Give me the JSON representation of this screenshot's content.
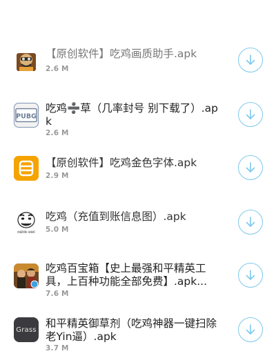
{
  "items": [
    {
      "title": "【原创软件】吃鸡画质助手.apk",
      "size": "2.6 M",
      "icon": "pubg-crate-character-icon"
    },
    {
      "title": "吃鸡➗草（几率封号 别下载了）.apk",
      "size": "2.6 M",
      "icon": "pubg-logo-icon"
    },
    {
      "title": "【原创软件】吃鸡金色字体.apk",
      "size": "2.9 M",
      "icon": "orange-app-icon"
    },
    {
      "title": "吃鸡（充值到账信息图）.apk",
      "size": "5.0 M",
      "icon": "meme-face-icon",
      "icon_caption": "充值到账 全能好"
    },
    {
      "title": "吃鸡百宝箱【史上最强和平精英工具，上百种功能全部免费】.apk...",
      "size": "7.6 M",
      "icon": "game-characters-icon"
    },
    {
      "title": "和平精英御草剂（吃鸡神器一键扫除老Yin逼）.apk",
      "size": "3.7 M",
      "icon": "grass-app-icon",
      "icon_text": "Grass"
    }
  ],
  "colors": {
    "accent": "#7cc8ec",
    "size_text": "#999999"
  }
}
